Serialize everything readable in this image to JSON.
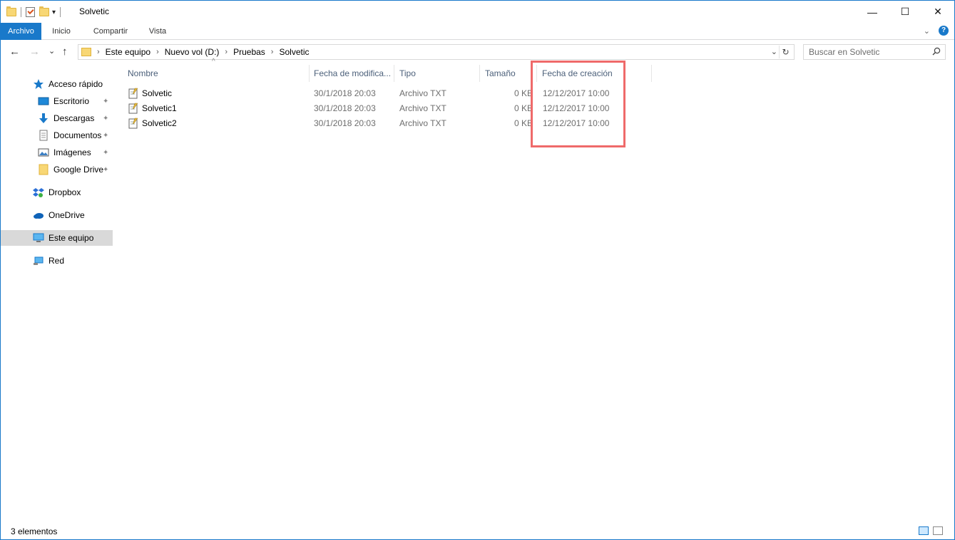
{
  "window": {
    "title": "Solvetic"
  },
  "window_buttons": {
    "minimize": "—",
    "maximize": "☐",
    "close": "✕"
  },
  "ribbon": {
    "tabs": [
      "Archivo",
      "Inicio",
      "Compartir",
      "Vista"
    ],
    "expand_glyph": "⌄",
    "help_glyph": "?"
  },
  "nav": {
    "back": "←",
    "forward": "→",
    "recent": "⌄",
    "up": "↑"
  },
  "address": {
    "crumbs": [
      "Este equipo",
      "Nuevo vol (D:)",
      "Pruebas",
      "Solvetic"
    ],
    "separator": "›",
    "dropdown": "⌄",
    "refresh": "↻"
  },
  "search": {
    "placeholder": "Buscar en Solvetic"
  },
  "sidebar": {
    "pin_glyph": "📌",
    "items": [
      {
        "label": "Acceso rápido",
        "icon": "star-icon"
      },
      {
        "label": "Escritorio",
        "icon": "desktop-icon",
        "pinned": true
      },
      {
        "label": "Descargas",
        "icon": "download-icon",
        "pinned": true
      },
      {
        "label": "Documentos",
        "icon": "document-icon",
        "pinned": true
      },
      {
        "label": "Imágenes",
        "icon": "pictures-icon",
        "pinned": true
      },
      {
        "label": "Google Drive",
        "icon": "folder-icon",
        "pinned": true
      },
      {
        "label": "Dropbox",
        "icon": "dropbox-icon"
      },
      {
        "label": "OneDrive",
        "icon": "cloud-icon"
      },
      {
        "label": "Este equipo",
        "icon": "computer-icon",
        "selected": true
      },
      {
        "label": "Red",
        "icon": "network-icon"
      }
    ]
  },
  "columns": {
    "name": "Nombre",
    "modified": "Fecha de modifica...",
    "type": "Tipo",
    "size": "Tamaño",
    "created": "Fecha de creación",
    "sort_glyph": "^"
  },
  "files": [
    {
      "name": "Solvetic",
      "modified": "30/1/2018 20:03",
      "type": "Archivo TXT",
      "size": "0 KB",
      "created": "12/12/2017 10:00"
    },
    {
      "name": "Solvetic1",
      "modified": "30/1/2018 20:03",
      "type": "Archivo TXT",
      "size": "0 KB",
      "created": "12/12/2017 10:00"
    },
    {
      "name": "Solvetic2",
      "modified": "30/1/2018 20:03",
      "type": "Archivo TXT",
      "size": "0 KB",
      "created": "12/12/2017 10:00"
    }
  ],
  "status": {
    "item_count": "3 elementos"
  },
  "colors": {
    "accent": "#1979ca",
    "highlight": "#ef6a6a",
    "selected": "#d9d9d9"
  }
}
